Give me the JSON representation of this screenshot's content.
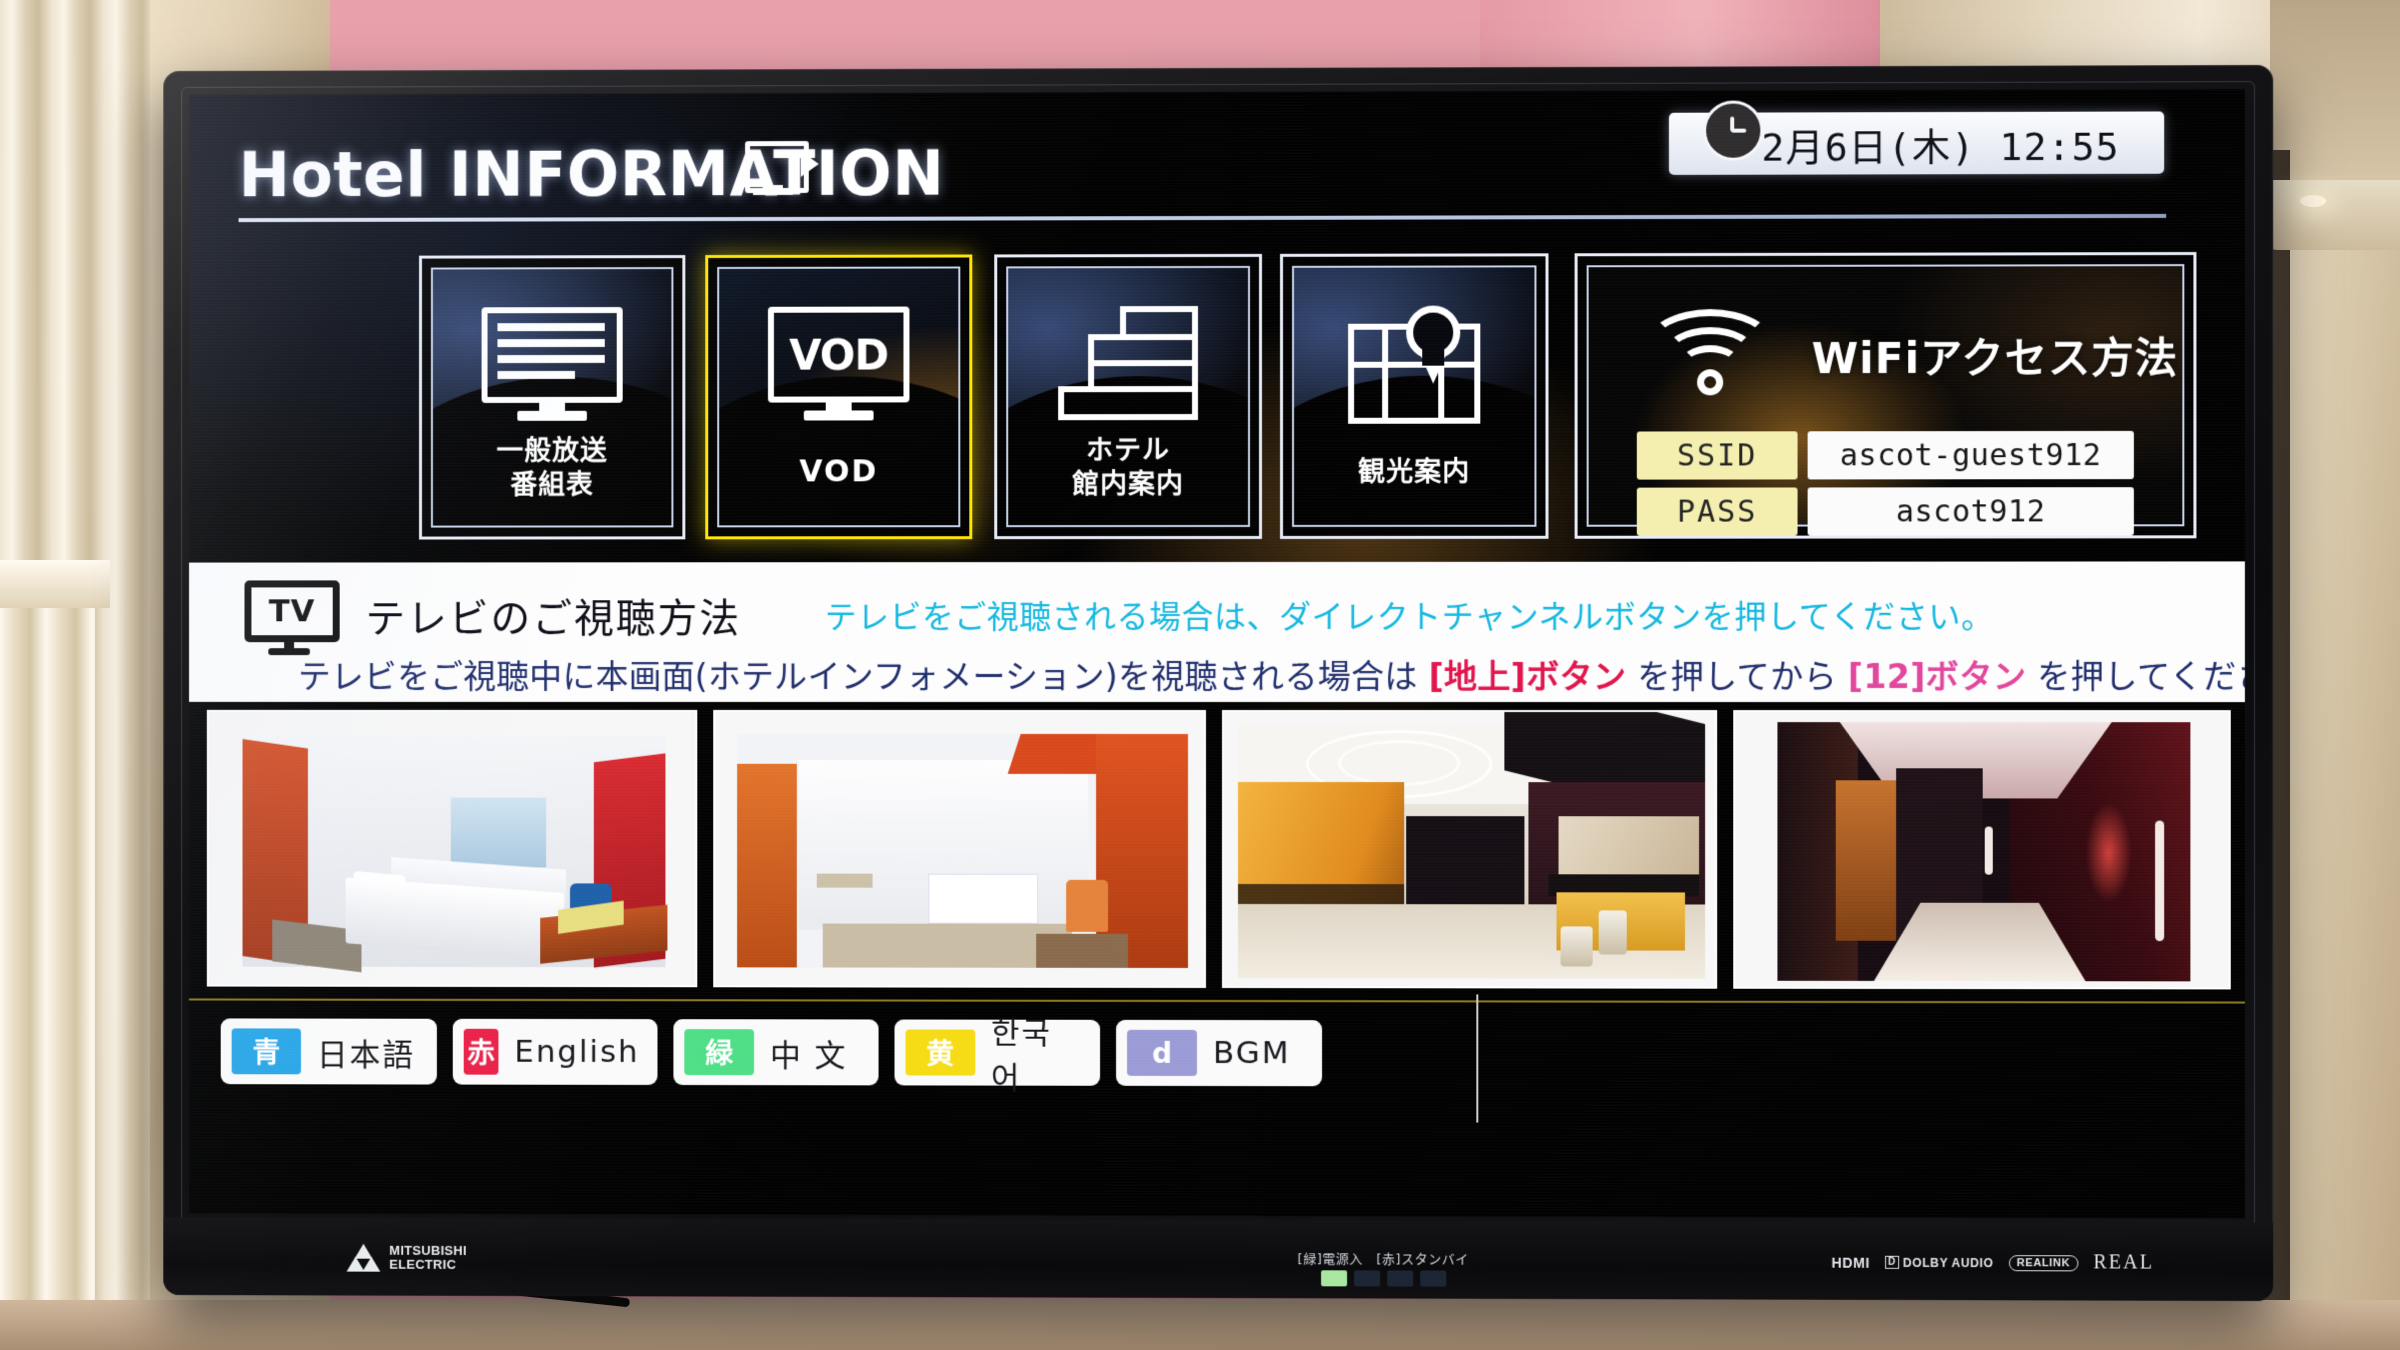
{
  "header": {
    "title": "Hotel INFORMATION",
    "tv_glyph": "tv-monitor-play",
    "clock": {
      "icon": "clock-icon",
      "datetime": "2月6日(木) 12:55"
    }
  },
  "menu_tiles": [
    {
      "id": "broadcast",
      "icon": "tv-program-list-icon",
      "label_line1": "一般放送",
      "label_line2": "番組表",
      "selected": false
    },
    {
      "id": "vod",
      "icon": "vod-monitor-icon",
      "icon_text": "VOD",
      "label_line1": "VOD",
      "label_line2": "",
      "selected": true
    },
    {
      "id": "hotel-guide",
      "icon": "building-icon",
      "label_line1": "ホテル",
      "label_line2": "館内案内",
      "selected": false
    },
    {
      "id": "sightseeing",
      "icon": "map-pin-icon",
      "label_line1": "観光案内",
      "label_line2": "",
      "selected": false
    }
  ],
  "wifi": {
    "icon": "wifi-icon",
    "title": "WiFiアクセス方法",
    "rows": [
      {
        "key": "SSID",
        "value": "ascot-guest912"
      },
      {
        "key": "PASS",
        "value": "ascot912"
      }
    ]
  },
  "info_band": {
    "badge": "TV",
    "heading": "テレビのご視聴方法",
    "cyan_note": "テレビをご視聴される場合は、ダイレクトチャンネルボタンを押してください。",
    "line2_parts": [
      {
        "text": "テレビをご視聴中に本画面(ホテルインフォメーション)を視聴される場合は ",
        "color": "navy"
      },
      {
        "text": "[地上]ボタン",
        "color": "red"
      },
      {
        "text": " を押してから ",
        "color": "navy"
      },
      {
        "text": "[12]ボタン",
        "color": "pink"
      },
      {
        "text": " を押してください。",
        "color": "navy"
      }
    ]
  },
  "photos": [
    {
      "id": "guest-room-twin",
      "alt": "hotel guest room with twin beds"
    },
    {
      "id": "guest-room-entry",
      "alt": "hotel room entry corridor with orange walls"
    },
    {
      "id": "lobby-reception",
      "alt": "hotel lobby reception area"
    },
    {
      "id": "elevator-corridor",
      "alt": "dark hotel corridor near elevators"
    }
  ],
  "language_buttons": [
    {
      "chip": "青",
      "chip_color": "#29a7e8",
      "label": "日本語"
    },
    {
      "chip": "赤",
      "chip_color": "#ea2048",
      "label": "English"
    },
    {
      "chip": "緑",
      "chip_color": "#4ede86",
      "label": "中 文"
    },
    {
      "chip": "黄",
      "chip_color": "#f5dc12",
      "label": "한국어"
    },
    {
      "chip": "d",
      "chip_color": "#9a9ad6",
      "label": "BGM"
    }
  ],
  "tv_hardware": {
    "brand_line1": "MITSUBISHI",
    "brand_line2": "ELECTRIC",
    "power_indicator": "[緑]電源入　[赤]スタンバイ",
    "badges": [
      "HDMI",
      "DOLBY AUDIO",
      "REALINK",
      "REAL"
    ]
  },
  "colors": {
    "accent_selected": "#ffe600",
    "cyan_text": "#13b7e0",
    "navy_text": "#1d2b6b",
    "red_text": "#e1134b",
    "pink_text": "#e1459c",
    "wifi_key_bg": "#f4efae"
  }
}
